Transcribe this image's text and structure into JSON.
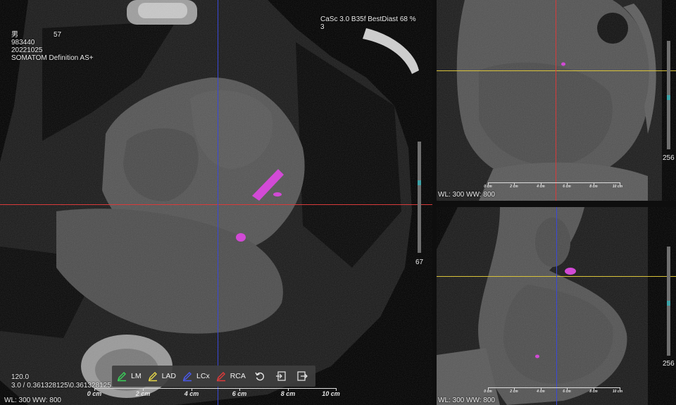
{
  "main_view": {
    "patient_sex": "男",
    "patient_age": "57",
    "patient_id": "983440",
    "study_date": "20221025",
    "scanner": "SOMATOM Definition AS+",
    "series_desc": "CaSc  3.0  B35f  BestDiast 68 %",
    "series_num": "3",
    "slice_number": "67",
    "kv": "120.0",
    "spacing": "3.0 / 0.361328125\\0.361328125",
    "window": "WL: 300 WW: 800",
    "ruler": [
      "0 cm",
      "2 cm",
      "4 cm",
      "6 cm",
      "8 cm",
      "10 cm"
    ]
  },
  "top_view": {
    "window": "WL: 300 WW: 800",
    "slice_number": "256",
    "ruler": [
      "0 cm",
      "2 cm",
      "4 cm",
      "6 cm",
      "8 cm",
      "10 cm"
    ]
  },
  "bottom_view": {
    "window": "WL: 300 WW: 800",
    "slice_number": "256",
    "ruler": [
      "0 cm",
      "2 cm",
      "4 cm",
      "6 cm",
      "8 cm",
      "10 cm"
    ]
  },
  "toolbar": {
    "lm_label": "LM",
    "lad_label": "LAD",
    "lcx_label": "LCx",
    "rca_label": "RCA"
  },
  "colors": {
    "lm": "#3ad35a",
    "lad": "#e8d84a",
    "lcx": "#3a4ae8",
    "rca": "#e03a3a",
    "calcium": "#d24ad6",
    "slider_thumb": "#3ea3a8"
  },
  "icons": {
    "lm": "pencil-icon",
    "lad": "pencil-icon",
    "lcx": "pencil-icon",
    "rca": "pencil-icon",
    "reset": "undo-icon",
    "import": "import-icon",
    "export": "export-icon"
  }
}
